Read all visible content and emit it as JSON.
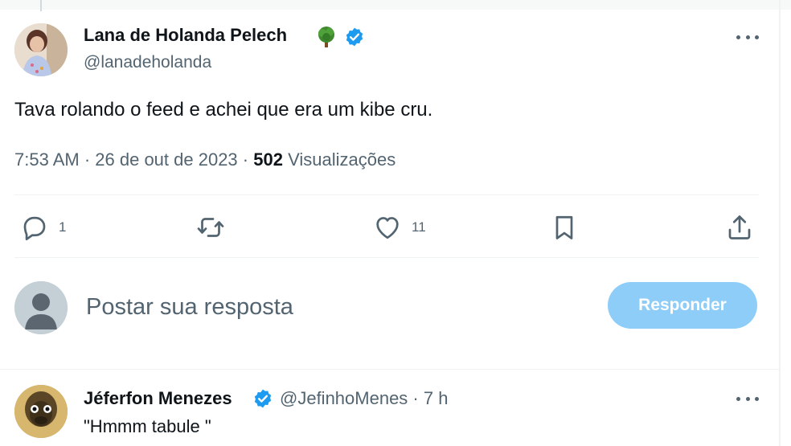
{
  "tweet": {
    "author_name": "Lana de Holanda Pelech",
    "author_handle": "@lanadeholanda",
    "text": "Tava rolando o feed e achei que era um kibe cru.",
    "time": "7:53 AM",
    "date": "26 de out de 2023",
    "views_count": "502",
    "views_label": "Visualizações",
    "badge_icons": [
      "tree-icon",
      "verified-icon"
    ]
  },
  "actions": {
    "reply_count": "1",
    "retweet_count": "",
    "like_count": "11"
  },
  "composer": {
    "placeholder": "Postar sua resposta",
    "button_label": "Responder"
  },
  "reply": {
    "author_name": "Jéferfon Menezes",
    "author_handle": "@JefinhoMenes",
    "time": "7 h",
    "text": "\"Hmmm tabule \""
  },
  "colors": {
    "verified": "#1d9bf0",
    "button_disabled": "#8ecdf8",
    "secondary_text": "#536471",
    "primary_text": "#0f1419"
  }
}
